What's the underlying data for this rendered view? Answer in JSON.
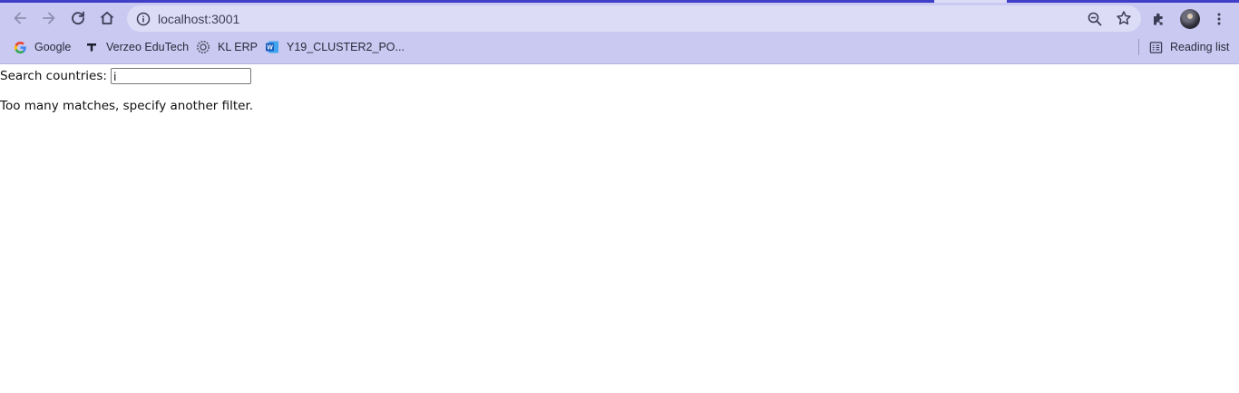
{
  "browser": {
    "url": "localhost:3001",
    "bookmarks": [
      {
        "label": "Google",
        "icon": "google-icon"
      },
      {
        "label": "Verzeo EduTech",
        "icon": "verzeo-icon"
      },
      {
        "label": "KL ERP",
        "icon": "kl-erp-icon"
      },
      {
        "label": "Y19_CLUSTER2_PO...",
        "icon": "word-doc-icon"
      }
    ],
    "reading_list_label": "Reading list",
    "colors": {
      "frame": "#c9c9f2",
      "tab_accent": "#3f3fc8",
      "omnibox": "#dcdcf7"
    }
  },
  "page": {
    "search_label": "Search countries:",
    "search_value": "i",
    "message": "Too many matches, specify another filter."
  }
}
